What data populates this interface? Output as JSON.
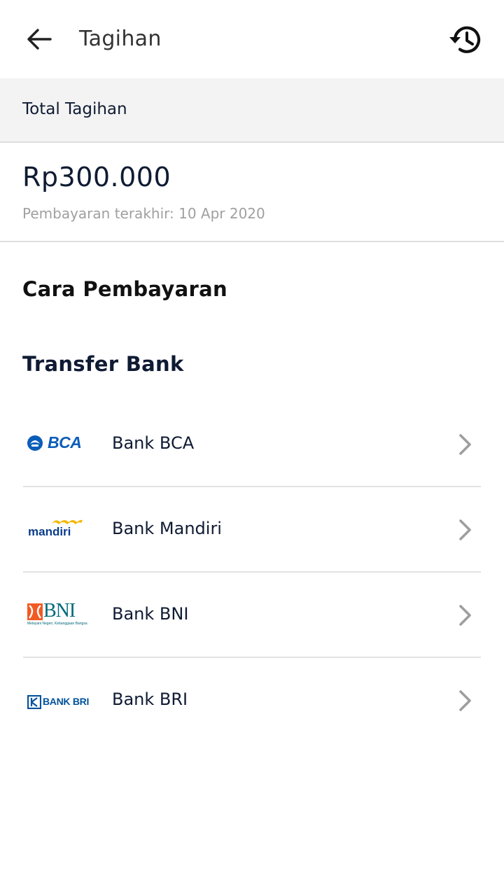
{
  "header": {
    "title": "Tagihan",
    "back_icon": "arrow-left-icon",
    "history_icon": "history-icon"
  },
  "total": {
    "label": "Total Tagihan",
    "amount": "Rp300.000",
    "last_payment": "Pembayaran terakhir: 10 Apr 2020"
  },
  "payment": {
    "section_title": "Cara Pembayaran",
    "method_title": "Transfer Bank",
    "banks": [
      {
        "name": "Bank BCA",
        "logo": "bca-logo",
        "logo_text": "BCA"
      },
      {
        "name": "Bank Mandiri",
        "logo": "mandiri-logo",
        "logo_text": "mandiri"
      },
      {
        "name": "Bank BNI",
        "logo": "bni-logo",
        "logo_text": "BNI",
        "logo_tagline": "Melayani Negeri, Kebanggaan Bangsa"
      },
      {
        "name": "Bank BRI",
        "logo": "bri-logo",
        "logo_text": "BANK BRI"
      }
    ]
  },
  "colors": {
    "text_primary": "#0f1b33",
    "text_muted": "#a0a0a0",
    "header_bg": "#f3f3f3",
    "divider": "#dedede",
    "chevron": "#9e9e9e",
    "bca_blue": "#0a5db8",
    "mandiri_blue": "#0b3d8c",
    "mandiri_gold": "#f5b700",
    "bni_orange": "#f15a22",
    "bni_teal": "#00697a",
    "bri_blue": "#00529c"
  }
}
